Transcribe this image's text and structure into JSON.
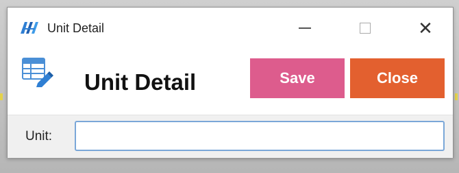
{
  "window": {
    "title": "Unit Detail",
    "app_icon": "app-logo-icon",
    "controls": {
      "minimize_icon": "minimize-icon",
      "maximize_icon": "maximize-icon",
      "close_icon": "close-icon",
      "close_glyph": "✕"
    }
  },
  "header": {
    "icon": "table-edit-icon",
    "title": "Unit Detail",
    "save_label": "Save",
    "close_label": "Close"
  },
  "form": {
    "unit_label": "Unit:",
    "unit_value": "",
    "unit_placeholder": ""
  },
  "colors": {
    "save_button": "#dd5c8d",
    "close_button": "#e3602f",
    "input_border": "#7aa7d8"
  }
}
